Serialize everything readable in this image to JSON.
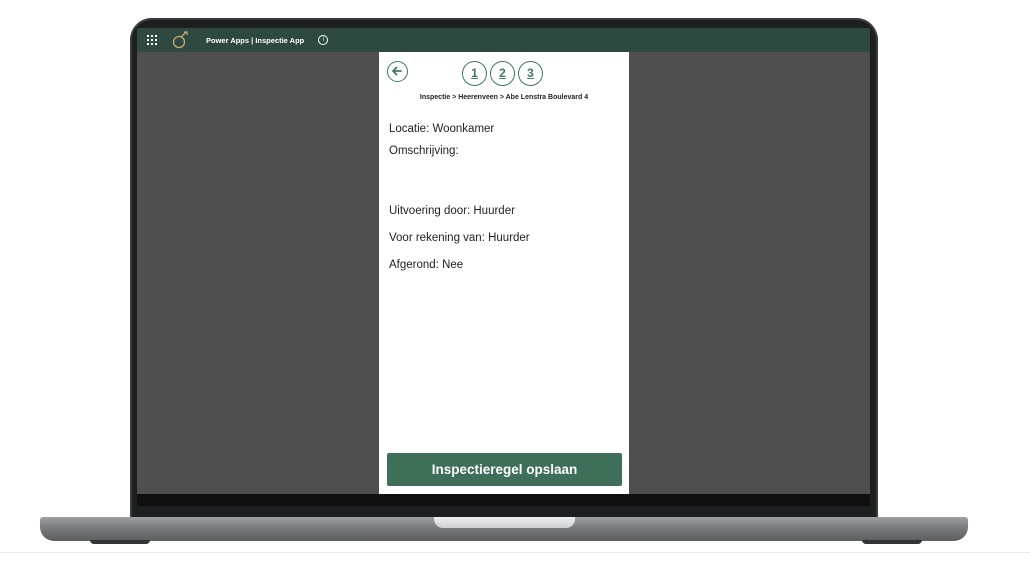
{
  "header": {
    "title": "Power Apps | Inspectie App",
    "icons": [
      "waffle-menu-icon",
      "app-logo-icon",
      "info-icon"
    ]
  },
  "nav": {
    "back_icon": "arrow-left-icon",
    "steps": [
      "1",
      "2",
      "3"
    ],
    "breadcrumb": "Inspectie > Heerenveen > Abe Lenstra Boulevard 4"
  },
  "details": {
    "locatie": "Locatie: Woonkamer",
    "omschrijving": "Omschrijving:",
    "uitvoering": "Uitvoering door: Huurder",
    "rekening": "Voor rekening van: Huurder",
    "afgerond": "Afgerond: Nee"
  },
  "actions": {
    "save_label": "Inspectieregel opslaan"
  },
  "colors": {
    "header_bg": "#2e4a40",
    "accent": "#3f7a5c",
    "button_bg": "#3e6f59",
    "canvas_bg": "#4f4f4f"
  }
}
